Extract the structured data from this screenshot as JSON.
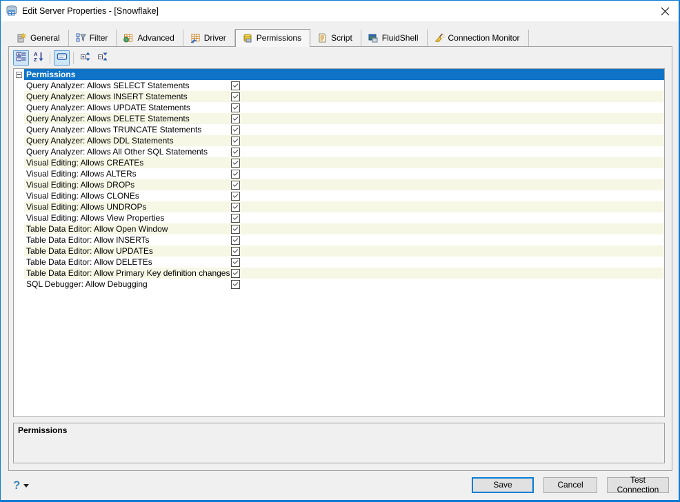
{
  "window": {
    "title": "Edit Server Properties - [Snowflake]",
    "icon": "database-server-icon",
    "border_color": "#0a7bd4"
  },
  "tabs": [
    {
      "label": "General",
      "icon": "server-new-icon",
      "selected": false
    },
    {
      "label": "Filter",
      "icon": "filter-tree-icon",
      "selected": false
    },
    {
      "label": "Advanced",
      "icon": "grid-green-dot-icon",
      "selected": false
    },
    {
      "label": "Driver",
      "icon": "grid-blue-arrow-icon",
      "selected": false
    },
    {
      "label": "Permissions",
      "icon": "database-yellow-icon",
      "selected": true
    },
    {
      "label": "Script",
      "icon": "script-page-icon",
      "selected": false
    },
    {
      "label": "FluidShell",
      "icon": "console-window-icon",
      "selected": false
    },
    {
      "label": "Connection Monitor",
      "icon": "broom-icon",
      "selected": false
    }
  ],
  "toolbar": {
    "buttons": [
      {
        "name": "categorized-view",
        "icon": "categorize-icon",
        "pressed": true
      },
      {
        "name": "sort-alphabetical",
        "icon": "sort-alpha-icon",
        "pressed": false
      },
      {
        "name": "show-description",
        "icon": "description-icon",
        "pressed": true
      },
      {
        "name": "expand-all",
        "icon": "expand-all-icon",
        "pressed": false
      },
      {
        "name": "collapse-all",
        "icon": "collapse-all-icon",
        "pressed": false
      }
    ]
  },
  "grid": {
    "category": "Permissions",
    "category_bg": "#0f74c8",
    "row_alt_bg": "#f7f7e6",
    "rows": [
      {
        "label": "Query Analyzer: Allows SELECT Statements",
        "checked": true
      },
      {
        "label": "Query Analyzer: Allows INSERT Statements",
        "checked": true
      },
      {
        "label": "Query Analyzer: Allows UPDATE Statements",
        "checked": true
      },
      {
        "label": "Query Analyzer: Allows DELETE Statements",
        "checked": true
      },
      {
        "label": "Query Analyzer: Allows TRUNCATE Statements",
        "checked": true
      },
      {
        "label": "Query Analyzer: Allows DDL Statements",
        "checked": true
      },
      {
        "label": "Query Analyzer: Allows All Other SQL Statements",
        "checked": true
      },
      {
        "label": "Visual Editing: Allows CREATEs",
        "checked": true
      },
      {
        "label": "Visual Editing: Allows ALTERs",
        "checked": true
      },
      {
        "label": "Visual Editing: Allows DROPs",
        "checked": true
      },
      {
        "label": "Visual Editing: Allows CLONEs",
        "checked": true
      },
      {
        "label": "Visual Editing: Allows UNDROPs",
        "checked": true
      },
      {
        "label": "Visual Editing: Allows View Properties",
        "checked": true
      },
      {
        "label": "Table Data Editor: Allow Open Window",
        "checked": true
      },
      {
        "label": "Table Data Editor: Allow INSERTs",
        "checked": true
      },
      {
        "label": "Table Data Editor: Allow UPDATEs",
        "checked": true
      },
      {
        "label": "Table Data Editor: Allow DELETEs",
        "checked": true
      },
      {
        "label": "Table Data Editor: Allow Primary Key definition changes",
        "checked": true
      },
      {
        "label": "SQL Debugger: Allow Debugging",
        "checked": true
      }
    ]
  },
  "description_panel": {
    "title": "Permissions"
  },
  "footer": {
    "help_icon": "help-question-icon",
    "save_label": "Save",
    "cancel_label": "Cancel",
    "test_label": "Test Connection"
  }
}
